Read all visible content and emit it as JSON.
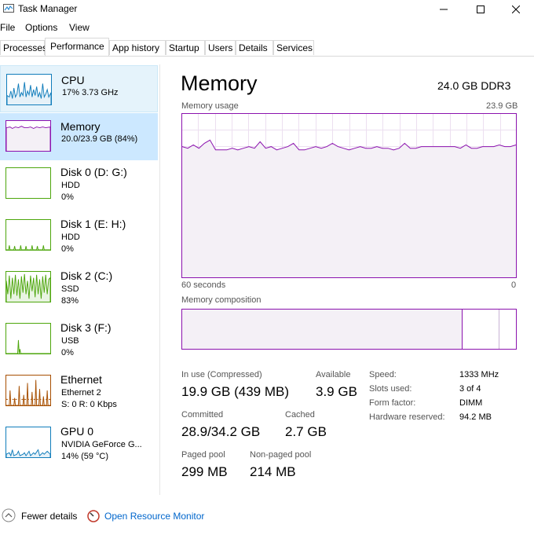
{
  "window": {
    "title": "Task Manager"
  },
  "menu": [
    "File",
    "Options",
    "View"
  ],
  "tabs": [
    "Processes",
    "Performance",
    "App history",
    "Startup",
    "Users",
    "Details",
    "Services"
  ],
  "sidebar": [
    {
      "name": "CPU",
      "sub1": "17%  3.73 GHz",
      "sub2": "",
      "color": "#117dbb"
    },
    {
      "name": "Memory",
      "sub1": "20.0/23.9 GB (84%)",
      "sub2": "",
      "color": "#8b12ae"
    },
    {
      "name": "Disk 0 (D: G:)",
      "sub1": "HDD",
      "sub2": "0%",
      "color": "#4da60c"
    },
    {
      "name": "Disk 1 (E: H:)",
      "sub1": "HDD",
      "sub2": "0%",
      "color": "#4da60c"
    },
    {
      "name": "Disk 2 (C:)",
      "sub1": "SSD",
      "sub2": "83%",
      "color": "#4da60c"
    },
    {
      "name": "Disk 3 (F:)",
      "sub1": "USB",
      "sub2": "0%",
      "color": "#4da60c"
    },
    {
      "name": "Ethernet",
      "sub1": "Ethernet 2",
      "sub2": "S: 0  R: 0 Kbps",
      "color": "#a74f01"
    },
    {
      "name": "GPU 0",
      "sub1": "NVIDIA GeForce G...",
      "sub2": "14%  (59 °C)",
      "color": "#117dbb"
    }
  ],
  "main": {
    "title": "Memory",
    "spec": "24.0 GB DDR3",
    "usage_label": "Memory usage",
    "usage_max": "23.9 GB",
    "time_left": "60 seconds",
    "time_right": "0",
    "composition_label": "Memory composition",
    "graph_color": "#8b12ae",
    "usage_points": [
      0.8,
      0.79,
      0.81,
      0.79,
      0.82,
      0.84,
      0.78,
      0.78,
      0.78,
      0.79,
      0.78,
      0.79,
      0.8,
      0.79,
      0.83,
      0.79,
      0.8,
      0.78,
      0.79,
      0.8,
      0.82,
      0.78,
      0.78,
      0.79,
      0.8,
      0.79,
      0.8,
      0.82,
      0.8,
      0.79,
      0.78,
      0.79,
      0.8,
      0.79,
      0.79,
      0.8,
      0.79,
      0.79,
      0.78,
      0.79,
      0.82,
      0.79,
      0.79,
      0.8,
      0.8,
      0.8,
      0.8,
      0.8,
      0.8,
      0.8,
      0.79,
      0.81,
      0.79,
      0.79,
      0.8,
      0.8,
      0.8,
      0.81,
      0.8,
      0.8,
      0.81
    ],
    "in_use_label": "In use (Compressed)",
    "in_use_value": "19.9 GB (439 MB)",
    "available_label": "Available",
    "available_value": "3.9 GB",
    "committed_label": "Committed",
    "committed_value": "28.9/34.2 GB",
    "cached_label": "Cached",
    "cached_value": "2.7 GB",
    "paged_label": "Paged pool",
    "paged_value": "299 MB",
    "nonpaged_label": "Non-paged pool",
    "nonpaged_value": "214 MB",
    "specs": [
      {
        "k": "Speed:",
        "v": "1333 MHz"
      },
      {
        "k": "Slots used:",
        "v": "3 of 4"
      },
      {
        "k": "Form factor:",
        "v": "DIMM"
      },
      {
        "k": "Hardware reserved:",
        "v": "94.2 MB"
      }
    ]
  },
  "footer": {
    "fewer": "Fewer details",
    "monitor": "Open Resource Monitor"
  }
}
